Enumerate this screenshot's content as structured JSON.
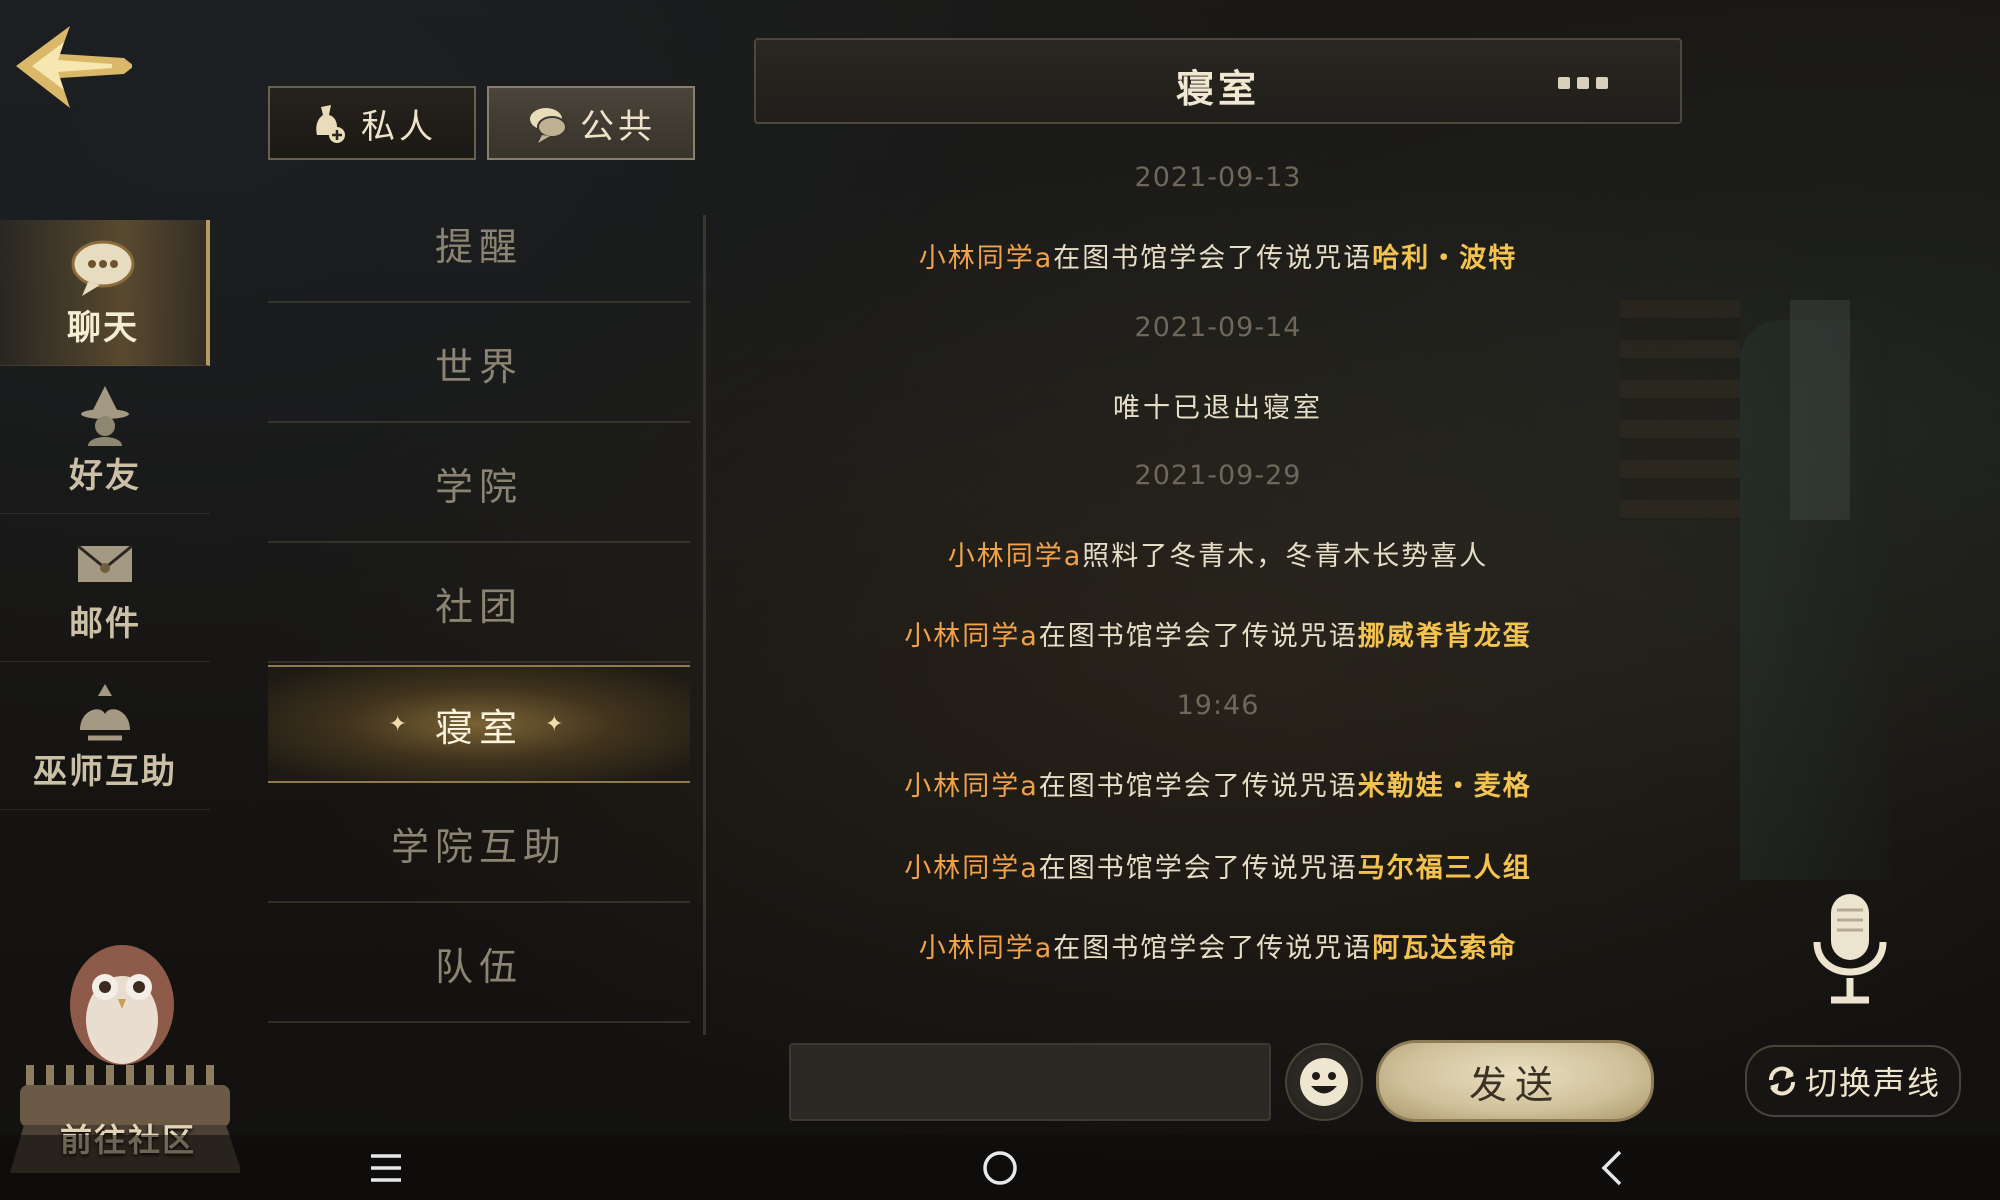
{
  "header": {
    "chat_title": "寝室"
  },
  "scope_tabs": [
    {
      "label": "私人",
      "active": false
    },
    {
      "label": "公共",
      "active": true
    }
  ],
  "categories": [
    {
      "label": "聊天",
      "icon": "chat-bubble-icon",
      "active": true
    },
    {
      "label": "好友",
      "icon": "wizard-hat-icon",
      "active": false
    },
    {
      "label": "邮件",
      "icon": "envelope-icon",
      "active": false
    },
    {
      "label": "巫师互助",
      "icon": "hands-icon",
      "active": false
    }
  ],
  "community": {
    "label": "前往社区",
    "icon": "owl-icon"
  },
  "channels": [
    {
      "label": "提醒",
      "active": false
    },
    {
      "label": "世界",
      "active": false
    },
    {
      "label": "学院",
      "active": false
    },
    {
      "label": "社团",
      "active": false
    },
    {
      "label": "寝室",
      "active": true
    },
    {
      "label": "学院互助",
      "active": false
    },
    {
      "label": "队伍",
      "active": false
    }
  ],
  "messages": {
    "d1": "2021-09-13",
    "m1": {
      "name": "小林同学a",
      "text": "在图书馆学会了传说咒语",
      "spell": "哈利・波特"
    },
    "d2": "2021-09-14",
    "m2": {
      "text": "唯十已退出寝室"
    },
    "d3": "2021-09-29",
    "m3": {
      "name": "小林同学a",
      "text": "照料了冬青木，冬青木长势喜人"
    },
    "m4": {
      "name": "小林同学a",
      "text": "在图书馆学会了传说咒语",
      "spell": "挪威脊背龙蛋"
    },
    "d4": "19:46",
    "m5": {
      "name": "小林同学a",
      "text": "在图书馆学会了传说咒语",
      "spell": "米勒娃・麦格"
    },
    "m6": {
      "name": "小林同学a",
      "text": "在图书馆学会了传说咒语",
      "spell": "马尔福三人组"
    },
    "m7": {
      "name": "小林同学a",
      "text": "在图书馆学会了传说咒语",
      "spell": "阿瓦达索命"
    }
  },
  "input": {
    "value": "",
    "placeholder": ""
  },
  "actions": {
    "send_label": "发送",
    "switch_voice_label": "切换声线"
  },
  "icons": {
    "back": "back-arrow-icon",
    "more": "more-dots-icon",
    "emoji": "smiley-icon",
    "mic": "microphone-icon",
    "switch": "switch-arrows-icon"
  },
  "nav": {
    "menu": "menu-icon",
    "home": "home-circle-icon",
    "back": "back-chevron-icon"
  },
  "colors": {
    "name": "#f0a24a",
    "spell": "#f4c24f",
    "accent_gold": "#b89a5e"
  }
}
